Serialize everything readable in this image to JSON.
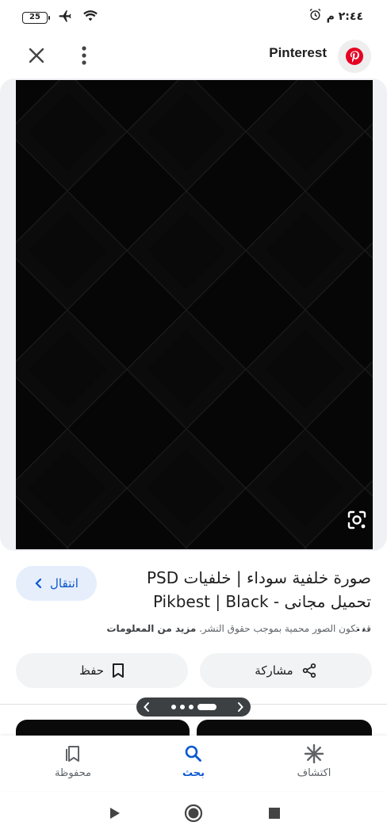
{
  "status_bar": {
    "battery": "25",
    "time": "٢:٤٤ م"
  },
  "top_bar": {
    "site_name": "Pinterest"
  },
  "result": {
    "title_line1": "صورة خلفية سوداء | خلفيات PSD",
    "title_line2": "تحميل مجانى - Pikbest | Black ...",
    "visit_label": "انتقال",
    "copyright_text": "قد تكون الصور محمية بموجب حقوق النشر.",
    "learn_more": "مزيد من المعلومات"
  },
  "actions": {
    "share_label": "مشاركة",
    "save_label": "حفظ"
  },
  "bottom_nav": {
    "discover": "اكتشاف",
    "search": "بحث",
    "saved": "محفوظة"
  },
  "colors": {
    "accent": "#0b57d0",
    "pinterest_red": "#e60023",
    "image_bg": "#050505"
  }
}
